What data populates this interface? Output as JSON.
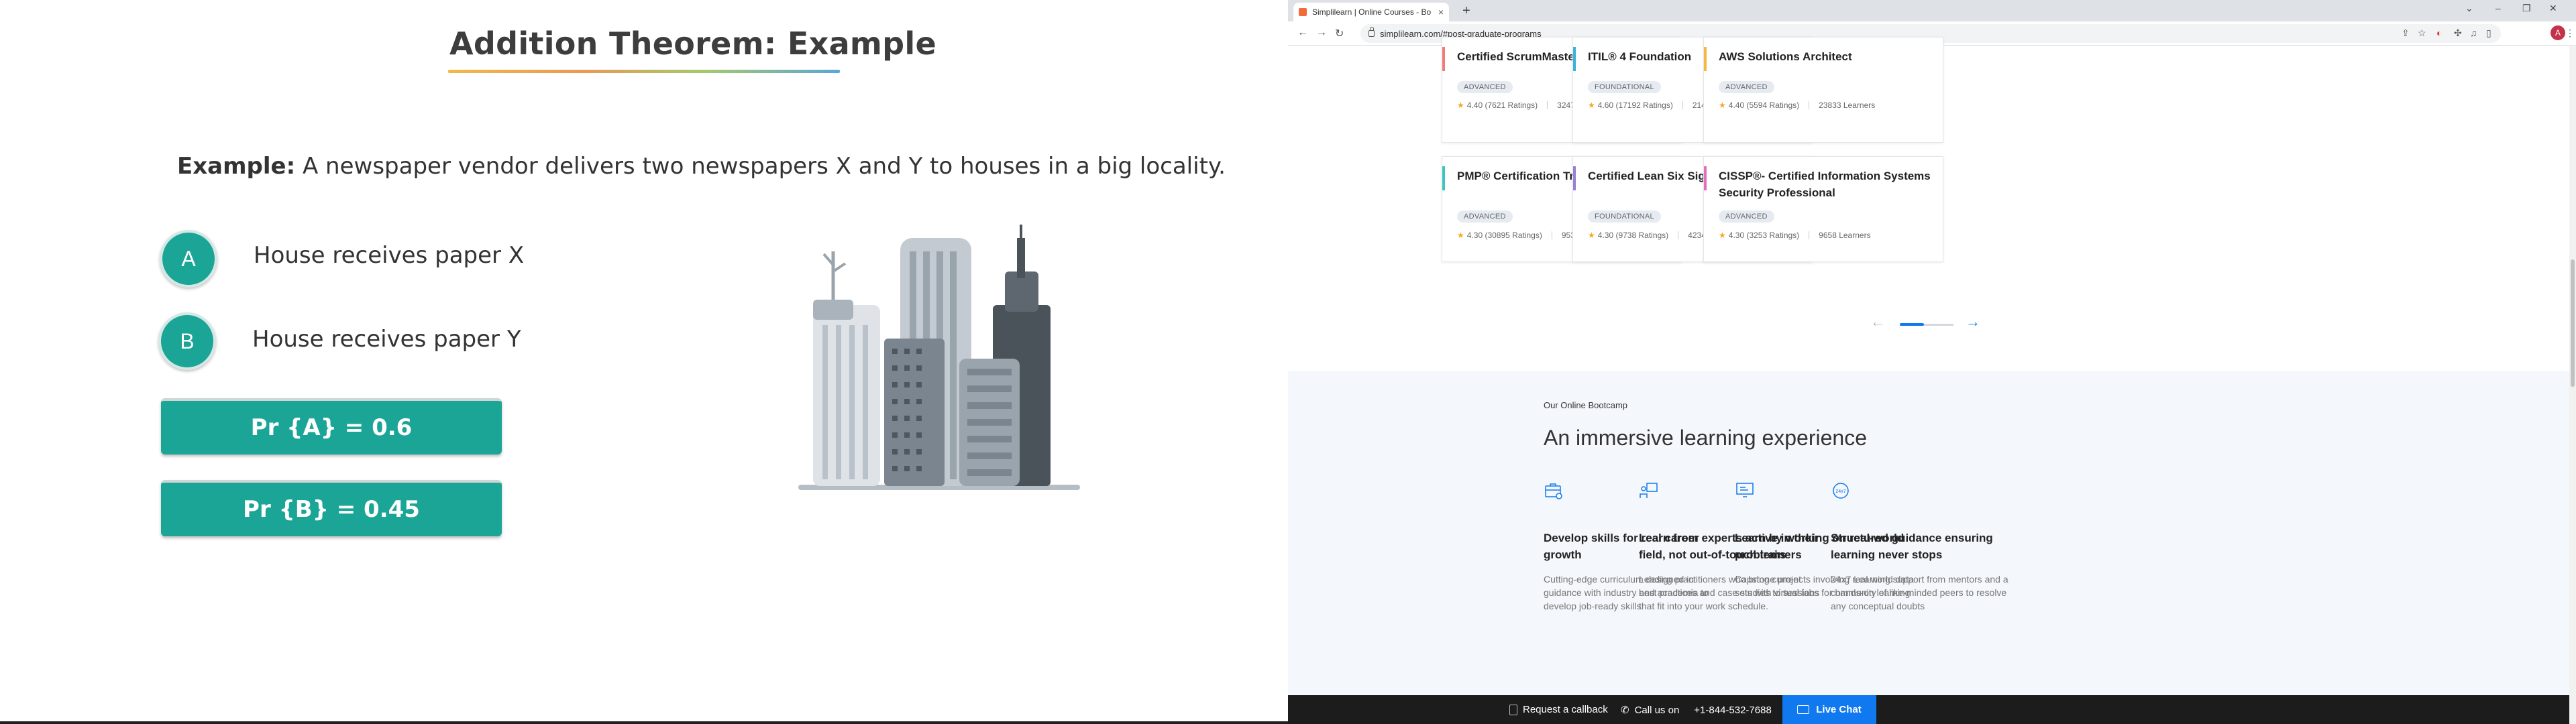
{
  "slide": {
    "title": "Addition Theorem: Example",
    "example_label": "Example:",
    "example_text": " A newspaper vendor delivers two newspapers X and Y to houses in a big locality.",
    "events": [
      {
        "letter": "A",
        "text": "House receives paper X"
      },
      {
        "letter": "B",
        "text": "House receives paper Y"
      }
    ],
    "probabilities": [
      "Pr {A} = 0.6",
      "Pr {B} = 0.45"
    ],
    "accent_color": "#1aa596"
  },
  "browser": {
    "tab_title": "Simplilearn | Online Courses - Bo",
    "url": "simplilearn.com/#post-graduate-programs",
    "avatar_letter": "A",
    "courses": [
      {
        "title": "Certified ScrumMaster® (CSM)",
        "level": "ADVANCED",
        "rating": "4.40 (7621 Ratings)",
        "learners": "32476 Learners",
        "bar_color": "#f07b7b"
      },
      {
        "title": "ITIL® 4 Foundation",
        "level": "FOUNDATIONAL",
        "rating": "4.60 (17192 Ratings)",
        "learners": "21498 Learners",
        "bar_color": "#35b5d9"
      },
      {
        "title": "AWS Solutions Architect",
        "level": "ADVANCED",
        "rating": "4.40 (5594 Ratings)",
        "learners": "23833 Learners",
        "bar_color": "#f5b942"
      },
      {
        "title": "PMP® Certification Training",
        "level": "ADVANCED",
        "rating": "4.30 (30895 Ratings)",
        "learners": "95382 Learners",
        "bar_color": "#3cc6c0"
      },
      {
        "title": "Certified Lean Six Sigma Green Belt",
        "level": "FOUNDATIONAL",
        "rating": "4.30 (9738 Ratings)",
        "learners": "42345 Learners",
        "bar_color": "#9b7ed6"
      },
      {
        "title": "CISSP®- Certified Information Systems Security Professional",
        "level": "ADVANCED",
        "rating": "4.30 (3253 Ratings)",
        "learners": "9658 Learners",
        "bar_color": "#e46fbd"
      }
    ],
    "bootcamp": {
      "eyebrow": "Our Online Bootcamp",
      "heading": "An immersive learning experience",
      "features": [
        {
          "icon": "briefcase-icon",
          "title": "Develop skills for real career growth",
          "text": "Cutting-edge curriculum designed in guidance with industry and academia to develop job-ready skills"
        },
        {
          "icon": "presenter-icon",
          "title": "Learn from experts active in their field, not out-of-touch trainers",
          "text": "Leading practitioners who bring current best practices and case studies to sessions that fit into your work schedule."
        },
        {
          "icon": "monitor-icon",
          "title": "Learn by working on real-world problems",
          "text": "Capstone projects involving real world data sets with virtual labs for hands-on learning"
        },
        {
          "icon": "support-24x7-icon",
          "title": "Structured guidance ensuring learning never stops",
          "text": "24x7 Learning support from mentors and a community of like-minded peers to resolve any conceptual doubts"
        }
      ]
    },
    "bottom_bar": {
      "callback": "Request a callback",
      "call_label": "Call us on",
      "phone": "+1-844-532-7688",
      "live_chat": "Live Chat"
    },
    "brand_color": "#1179ef"
  }
}
